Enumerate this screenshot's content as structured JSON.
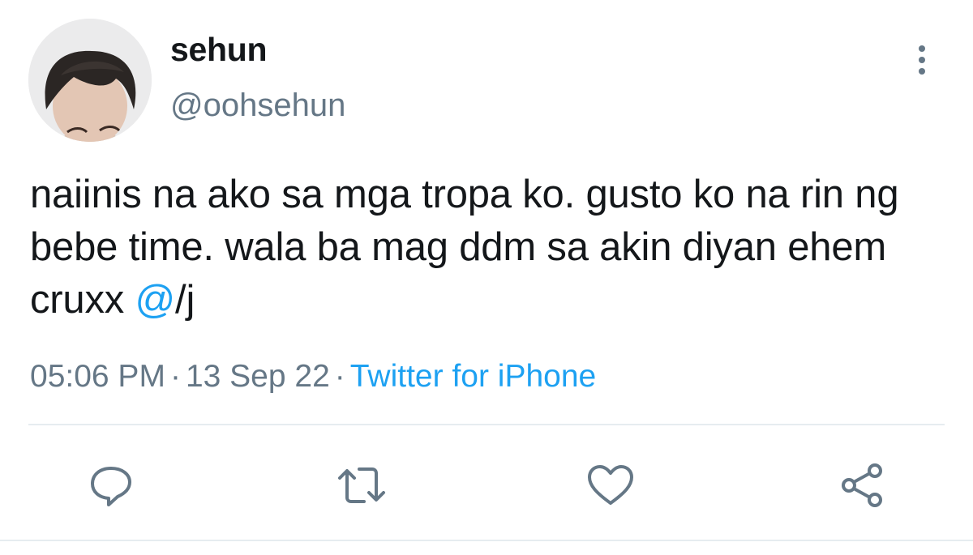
{
  "author": {
    "display_name": "sehun",
    "handle": "@oohsehun"
  },
  "tweet": {
    "text_before": "naiinis na ako sa mga tropa ko. gusto ko na rin ng bebe time. wala ba mag ddm sa akin diyan ehem cruxx ",
    "mention": "@",
    "text_after": "/j"
  },
  "meta": {
    "time": "05:06 PM",
    "separator": "·",
    "date": "13 Sep 22",
    "source": "Twitter for iPhone"
  },
  "actions": [
    {
      "name": "reply",
      "icon": "reply-icon"
    },
    {
      "name": "retweet",
      "icon": "retweet-icon"
    },
    {
      "name": "like",
      "icon": "heart-icon"
    },
    {
      "name": "share",
      "icon": "share-icon"
    }
  ],
  "colors": {
    "text": "#14171a",
    "secondary": "#657786",
    "link": "#1da1f2",
    "divider": "#e6ecf0"
  }
}
